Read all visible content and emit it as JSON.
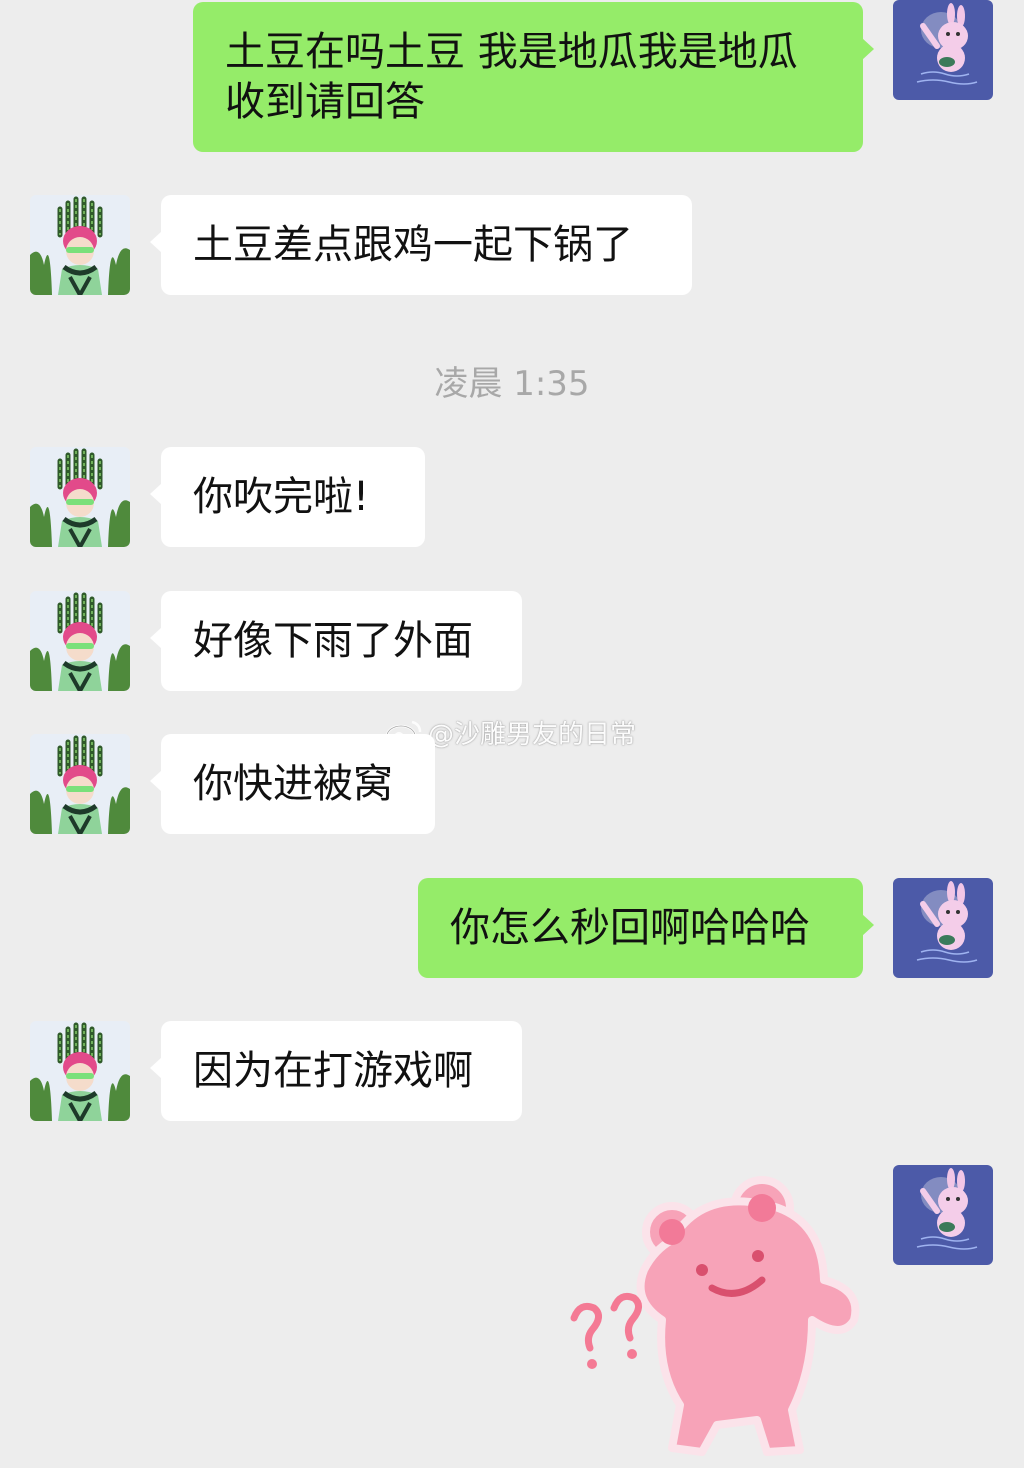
{
  "colors": {
    "background": "#ededed",
    "incoming_bubble": "#ffffff",
    "outgoing_bubble": "#95ec69",
    "timestamp_text": "#a8a8a8"
  },
  "messages": [
    {
      "side": "out",
      "text": "土豆在吗土豆 我是地瓜我是地瓜收到请回答"
    },
    {
      "side": "in",
      "text": "土豆差点跟鸡一起下锅了"
    },
    {
      "side": "in",
      "text": "你吹完啦!"
    },
    {
      "side": "in",
      "text": "好像下雨了外面"
    },
    {
      "side": "in",
      "text": "你快进被窝"
    },
    {
      "side": "out",
      "text": "你怎么秒回啊哈哈哈"
    },
    {
      "side": "in",
      "text": "因为在打游戏啊"
    },
    {
      "side": "out",
      "sticker": "pink-bear-sticker"
    }
  ],
  "timestamp": "凌晨 1:35",
  "watermark": {
    "icon": "weibo-icon",
    "text": "@沙雕男友的日常"
  },
  "avatars": {
    "self": "pink-rabbit-avatar",
    "other": "pink-haired-character-avatar"
  }
}
